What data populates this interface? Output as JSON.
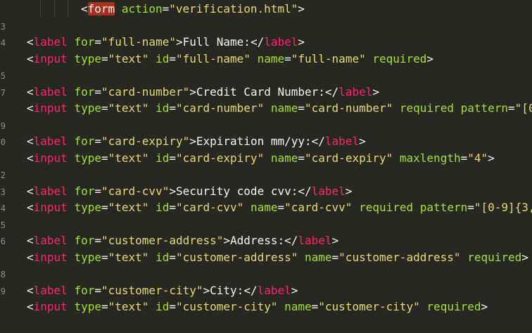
{
  "editor": {
    "colors": {
      "background": "#272822",
      "punctuation": "#f8f8f2",
      "tag": "#f92672",
      "attribute": "#a6e22e",
      "string": "#e6db74",
      "text": "#f8f8f2",
      "tag_highlight": "#a6321e",
      "line_number": "#8f908a"
    },
    "line_numbers": [
      "",
      "3",
      "4",
      "",
      "5",
      "7",
      "",
      "9",
      "0",
      "",
      "2",
      "3",
      "4",
      "5",
      "6",
      "",
      "8",
      "9",
      ""
    ],
    "lines": [
      {
        "tokens": [
          {
            "type": "punct",
            "text": "<"
          },
          {
            "type": "tag",
            "text": "form",
            "highlight": true
          },
          {
            "type": "punct",
            "text": " "
          },
          {
            "type": "attr",
            "text": "action"
          },
          {
            "type": "punct",
            "text": "="
          },
          {
            "type": "str",
            "text": "\"verification.html\""
          },
          {
            "type": "punct",
            "text": ">"
          }
        ]
      },
      {
        "tokens": []
      },
      {
        "tokens": [
          {
            "type": "punct",
            "text": "<"
          },
          {
            "type": "tag",
            "text": "label"
          },
          {
            "type": "punct",
            "text": " "
          },
          {
            "type": "attr",
            "text": "for"
          },
          {
            "type": "punct",
            "text": "="
          },
          {
            "type": "str",
            "text": "\"full-name\""
          },
          {
            "type": "punct",
            "text": ">"
          },
          {
            "type": "text",
            "text": "Full Name:"
          },
          {
            "type": "punct",
            "text": "</"
          },
          {
            "type": "tag",
            "text": "label"
          },
          {
            "type": "punct",
            "text": ">"
          }
        ]
      },
      {
        "tokens": [
          {
            "type": "punct",
            "text": "<"
          },
          {
            "type": "tag",
            "text": "input"
          },
          {
            "type": "punct",
            "text": " "
          },
          {
            "type": "attr",
            "text": "type"
          },
          {
            "type": "punct",
            "text": "="
          },
          {
            "type": "str",
            "text": "\"text\""
          },
          {
            "type": "punct",
            "text": " "
          },
          {
            "type": "attr",
            "text": "id"
          },
          {
            "type": "punct",
            "text": "="
          },
          {
            "type": "str",
            "text": "\"full-name\""
          },
          {
            "type": "punct",
            "text": " "
          },
          {
            "type": "attr",
            "text": "name"
          },
          {
            "type": "punct",
            "text": "="
          },
          {
            "type": "str",
            "text": "\"full-name\""
          },
          {
            "type": "punct",
            "text": " "
          },
          {
            "type": "attr",
            "text": "required"
          },
          {
            "type": "punct",
            "text": ">"
          }
        ]
      },
      {
        "tokens": []
      },
      {
        "tokens": [
          {
            "type": "punct",
            "text": "<"
          },
          {
            "type": "tag",
            "text": "label"
          },
          {
            "type": "punct",
            "text": " "
          },
          {
            "type": "attr",
            "text": "for"
          },
          {
            "type": "punct",
            "text": "="
          },
          {
            "type": "str",
            "text": "\"card-number\""
          },
          {
            "type": "punct",
            "text": ">"
          },
          {
            "type": "text",
            "text": "Credit Card Number:"
          },
          {
            "type": "punct",
            "text": "</"
          },
          {
            "type": "tag",
            "text": "label"
          },
          {
            "type": "punct",
            "text": ">"
          }
        ]
      },
      {
        "tokens": [
          {
            "type": "punct",
            "text": "<"
          },
          {
            "type": "tag",
            "text": "input"
          },
          {
            "type": "punct",
            "text": " "
          },
          {
            "type": "attr",
            "text": "type"
          },
          {
            "type": "punct",
            "text": "="
          },
          {
            "type": "str",
            "text": "\"text\""
          },
          {
            "type": "punct",
            "text": " "
          },
          {
            "type": "attr",
            "text": "id"
          },
          {
            "type": "punct",
            "text": "="
          },
          {
            "type": "str",
            "text": "\"card-number\""
          },
          {
            "type": "punct",
            "text": " "
          },
          {
            "type": "attr",
            "text": "name"
          },
          {
            "type": "punct",
            "text": "="
          },
          {
            "type": "str",
            "text": "\"card-number\""
          },
          {
            "type": "punct",
            "text": " "
          },
          {
            "type": "attr",
            "text": "required"
          },
          {
            "type": "punct",
            "text": " "
          },
          {
            "type": "attr",
            "text": "pattern"
          },
          {
            "type": "punct",
            "text": "="
          },
          {
            "type": "str",
            "text": "\"[0"
          }
        ]
      },
      {
        "tokens": []
      },
      {
        "tokens": [
          {
            "type": "punct",
            "text": "<"
          },
          {
            "type": "tag",
            "text": "label"
          },
          {
            "type": "punct",
            "text": " "
          },
          {
            "type": "attr",
            "text": "for"
          },
          {
            "type": "punct",
            "text": "="
          },
          {
            "type": "str",
            "text": "\"card-expiry\""
          },
          {
            "type": "punct",
            "text": ">"
          },
          {
            "type": "text",
            "text": "Expiration mm/yy:"
          },
          {
            "type": "punct",
            "text": "</"
          },
          {
            "type": "tag",
            "text": "label"
          },
          {
            "type": "punct",
            "text": ">"
          }
        ]
      },
      {
        "tokens": [
          {
            "type": "punct",
            "text": "<"
          },
          {
            "type": "tag",
            "text": "input"
          },
          {
            "type": "punct",
            "text": " "
          },
          {
            "type": "attr",
            "text": "type"
          },
          {
            "type": "punct",
            "text": "="
          },
          {
            "type": "str",
            "text": "\"text\""
          },
          {
            "type": "punct",
            "text": " "
          },
          {
            "type": "attr",
            "text": "id"
          },
          {
            "type": "punct",
            "text": "="
          },
          {
            "type": "str",
            "text": "\"card-expiry\""
          },
          {
            "type": "punct",
            "text": " "
          },
          {
            "type": "attr",
            "text": "name"
          },
          {
            "type": "punct",
            "text": "="
          },
          {
            "type": "str",
            "text": "\"card-expiry\""
          },
          {
            "type": "punct",
            "text": " "
          },
          {
            "type": "attr",
            "text": "maxlength"
          },
          {
            "type": "punct",
            "text": "="
          },
          {
            "type": "str",
            "text": "\"4\""
          },
          {
            "type": "punct",
            "text": ">"
          }
        ]
      },
      {
        "tokens": []
      },
      {
        "tokens": [
          {
            "type": "punct",
            "text": "<"
          },
          {
            "type": "tag",
            "text": "label"
          },
          {
            "type": "punct",
            "text": " "
          },
          {
            "type": "attr",
            "text": "for"
          },
          {
            "type": "punct",
            "text": "="
          },
          {
            "type": "str",
            "text": "\"card-cvv\""
          },
          {
            "type": "punct",
            "text": ">"
          },
          {
            "type": "text",
            "text": "Security code cvv:"
          },
          {
            "type": "punct",
            "text": "</"
          },
          {
            "type": "tag",
            "text": "label"
          },
          {
            "type": "punct",
            "text": ">"
          }
        ]
      },
      {
        "tokens": [
          {
            "type": "punct",
            "text": "<"
          },
          {
            "type": "tag",
            "text": "input"
          },
          {
            "type": "punct",
            "text": " "
          },
          {
            "type": "attr",
            "text": "type"
          },
          {
            "type": "punct",
            "text": "="
          },
          {
            "type": "str",
            "text": "\"text\""
          },
          {
            "type": "punct",
            "text": " "
          },
          {
            "type": "attr",
            "text": "id"
          },
          {
            "type": "punct",
            "text": "="
          },
          {
            "type": "str",
            "text": "\"card-cvv\""
          },
          {
            "type": "punct",
            "text": " "
          },
          {
            "type": "attr",
            "text": "name"
          },
          {
            "type": "punct",
            "text": "="
          },
          {
            "type": "str",
            "text": "\"card-cvv\""
          },
          {
            "type": "punct",
            "text": " "
          },
          {
            "type": "attr",
            "text": "required"
          },
          {
            "type": "punct",
            "text": " "
          },
          {
            "type": "attr",
            "text": "pattern"
          },
          {
            "type": "punct",
            "text": "="
          },
          {
            "type": "str",
            "text": "\"[0-9]{3,"
          }
        ]
      },
      {
        "tokens": []
      },
      {
        "tokens": [
          {
            "type": "punct",
            "text": "<"
          },
          {
            "type": "tag",
            "text": "label"
          },
          {
            "type": "punct",
            "text": " "
          },
          {
            "type": "attr",
            "text": "for"
          },
          {
            "type": "punct",
            "text": "="
          },
          {
            "type": "str",
            "text": "\"customer-address\""
          },
          {
            "type": "punct",
            "text": ">"
          },
          {
            "type": "text",
            "text": "Address:"
          },
          {
            "type": "punct",
            "text": "</"
          },
          {
            "type": "tag",
            "text": "label"
          },
          {
            "type": "punct",
            "text": ">"
          }
        ]
      },
      {
        "tokens": [
          {
            "type": "punct",
            "text": "<"
          },
          {
            "type": "tag",
            "text": "input"
          },
          {
            "type": "punct",
            "text": " "
          },
          {
            "type": "attr",
            "text": "type"
          },
          {
            "type": "punct",
            "text": "="
          },
          {
            "type": "str",
            "text": "\"text\""
          },
          {
            "type": "punct",
            "text": " "
          },
          {
            "type": "attr",
            "text": "id"
          },
          {
            "type": "punct",
            "text": "="
          },
          {
            "type": "str",
            "text": "\"customer-address\""
          },
          {
            "type": "punct",
            "text": " "
          },
          {
            "type": "attr",
            "text": "name"
          },
          {
            "type": "punct",
            "text": "="
          },
          {
            "type": "str",
            "text": "\"customer-address\""
          },
          {
            "type": "punct",
            "text": " "
          },
          {
            "type": "attr",
            "text": "required"
          },
          {
            "type": "punct",
            "text": ">"
          }
        ]
      },
      {
        "tokens": []
      },
      {
        "tokens": [
          {
            "type": "punct",
            "text": "<"
          },
          {
            "type": "tag",
            "text": "label"
          },
          {
            "type": "punct",
            "text": " "
          },
          {
            "type": "attr",
            "text": "for"
          },
          {
            "type": "punct",
            "text": "="
          },
          {
            "type": "str",
            "text": "\"customer-city\""
          },
          {
            "type": "punct",
            "text": ">"
          },
          {
            "type": "text",
            "text": "City:"
          },
          {
            "type": "punct",
            "text": "</"
          },
          {
            "type": "tag",
            "text": "label"
          },
          {
            "type": "punct",
            "text": ">"
          }
        ]
      },
      {
        "tokens": [
          {
            "type": "punct",
            "text": "<"
          },
          {
            "type": "tag",
            "text": "input"
          },
          {
            "type": "punct",
            "text": " "
          },
          {
            "type": "attr",
            "text": "type"
          },
          {
            "type": "punct",
            "text": "="
          },
          {
            "type": "str",
            "text": "\"text\""
          },
          {
            "type": "punct",
            "text": " "
          },
          {
            "type": "attr",
            "text": "id"
          },
          {
            "type": "punct",
            "text": "="
          },
          {
            "type": "str",
            "text": "\"customer-city\""
          },
          {
            "type": "punct",
            "text": " "
          },
          {
            "type": "attr",
            "text": "name"
          },
          {
            "type": "punct",
            "text": "="
          },
          {
            "type": "str",
            "text": "\"customer-city\""
          },
          {
            "type": "punct",
            "text": " "
          },
          {
            "type": "attr",
            "text": "required"
          },
          {
            "type": "punct",
            "text": ">"
          }
        ]
      },
      {
        "tokens": []
      }
    ]
  }
}
